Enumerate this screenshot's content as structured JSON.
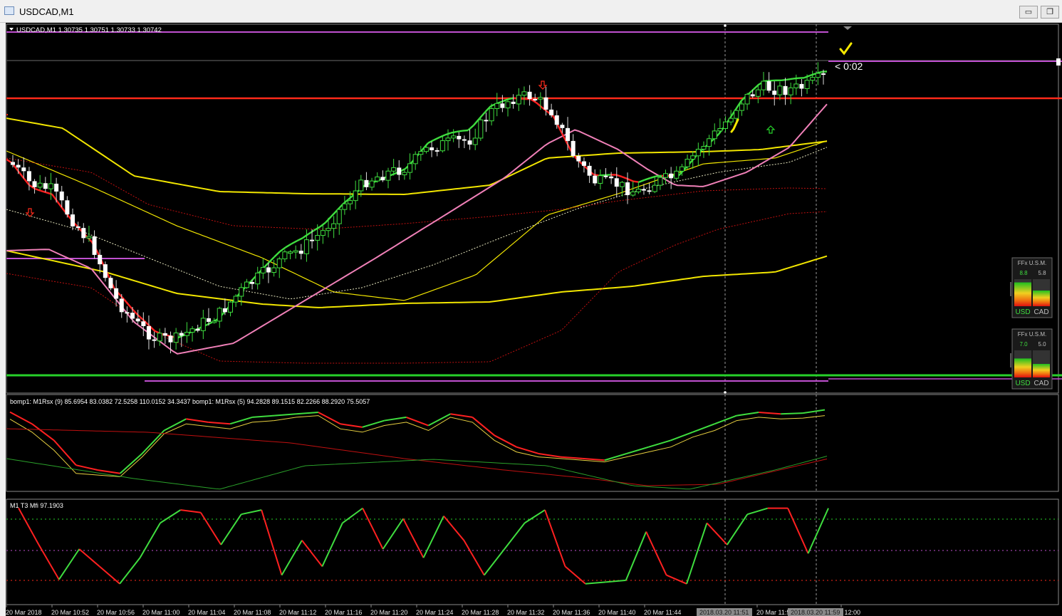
{
  "window": {
    "title": "USDCAD,M1",
    "minimize_glyph": "▭",
    "restore_glyph": "❐"
  },
  "main_panel": {
    "header": "USDCAD,M1  1.30735 1.30751 1.30733 1.30742",
    "countdown": "< 0:02",
    "colors": {
      "background": "#000000",
      "resistance": "#ff2a1a",
      "support": "#27d12a",
      "level": "#c050d0"
    }
  },
  "usm_widgets": [
    {
      "title": "FFx U.S.M.",
      "usd_value": "8.8",
      "cad_value": "5.8",
      "usd_label": "USD",
      "cad_label": "CAD",
      "usd_strength": 0.88,
      "cad_strength": 0.58
    },
    {
      "title": "FFx U.S.M.",
      "usd_value": "7.0",
      "cad_value": "5.0",
      "usd_label": "USD",
      "cad_label": "CAD",
      "usd_strength": 0.7,
      "cad_strength": 0.5
    }
  ],
  "rsx_panel": {
    "label": "bomp1: M1Rsx (9) 85.6954 83.0382 72.5258 110.0152 34.3437  bomp1: M1Rsx (5) 94.2828 89.1515 82.2266 88.2920 75.5057"
  },
  "mfi_panel": {
    "label": "M1  T3 Mfi  97.1903"
  },
  "time_axis": {
    "labels": [
      "20 Mar 2018",
      "20 Mar 10:52",
      "20 Mar 10:56",
      "20 Mar 11:00",
      "20 Mar 11:04",
      "20 Mar 11:08",
      "20 Mar 11:12",
      "20 Mar 11:16",
      "20 Mar 11:20",
      "20 Mar 11:24",
      "20 Mar 11:28",
      "20 Mar 11:32",
      "20 Mar 11:36",
      "20 Mar 11:40",
      "20 Mar 11:44",
      "20 Mar 11:52",
      "r 12:00"
    ],
    "cursor_labels": [
      "2018.03.20 11:51",
      "2018.03.20 11:59"
    ]
  },
  "chart_data": [
    {
      "type": "candlestick",
      "title": "USDCAD,M1",
      "ohlc_printed": {
        "open": 1.30735,
        "high": 1.30751,
        "low": 1.30733,
        "close": 1.30742
      },
      "price_trace": [
        0.77,
        0.69,
        0.67,
        0.56,
        0.46,
        0.28,
        0.19,
        0.13,
        0.13,
        0.18,
        0.22,
        0.3,
        0.36,
        0.42,
        0.46,
        0.52,
        0.62,
        0.7,
        0.73,
        0.75,
        0.82,
        0.84,
        0.85,
        0.95,
        1.0,
        1.01,
        0.95,
        0.79,
        0.7,
        0.69,
        0.66,
        0.7,
        0.72,
        0.82,
        0.89,
        0.99,
        1.04,
        1.03,
        1.04,
        1.08
      ],
      "grid": false
    },
    {
      "type": "line",
      "title": "bomp1: M1Rsx",
      "series": [
        {
          "name": "M1Rsx (9)",
          "values": [
            85.7,
            70,
            48,
            20,
            18,
            16,
            40,
            68,
            80,
            77,
            74,
            82,
            84,
            88,
            90,
            74,
            70,
            78,
            82,
            72,
            88,
            82,
            60,
            46,
            40,
            38,
            36,
            34,
            40,
            46,
            52,
            64,
            72,
            84,
            88,
            86,
            87,
            90
          ]
        },
        {
          "name": "M1Rsx (5)",
          "values": [
            94.3,
            80,
            60,
            30,
            24,
            20,
            44,
            72,
            86,
            82,
            80,
            88,
            90,
            92,
            94,
            80,
            76,
            84,
            88,
            78,
            92,
            88,
            66,
            52,
            44,
            40,
            38,
            36,
            44,
            52,
            60,
            70,
            80,
            90,
            94,
            92,
            93,
            97
          ]
        }
      ]
    },
    {
      "type": "line",
      "title": "T3 Mfi",
      "series": [
        {
          "name": "T3 Mfi",
          "values": [
            97.2,
            55,
            15,
            50,
            30,
            10,
            40,
            80,
            95,
            92,
            55,
            90,
            95,
            20,
            60,
            30,
            80,
            97,
            50,
            85,
            40,
            88,
            60,
            20,
            50,
            80,
            95,
            30,
            10,
            12,
            14,
            70,
            20,
            10,
            80,
            55,
            90,
            97,
            97,
            45,
            97
          ]
        }
      ]
    }
  ]
}
